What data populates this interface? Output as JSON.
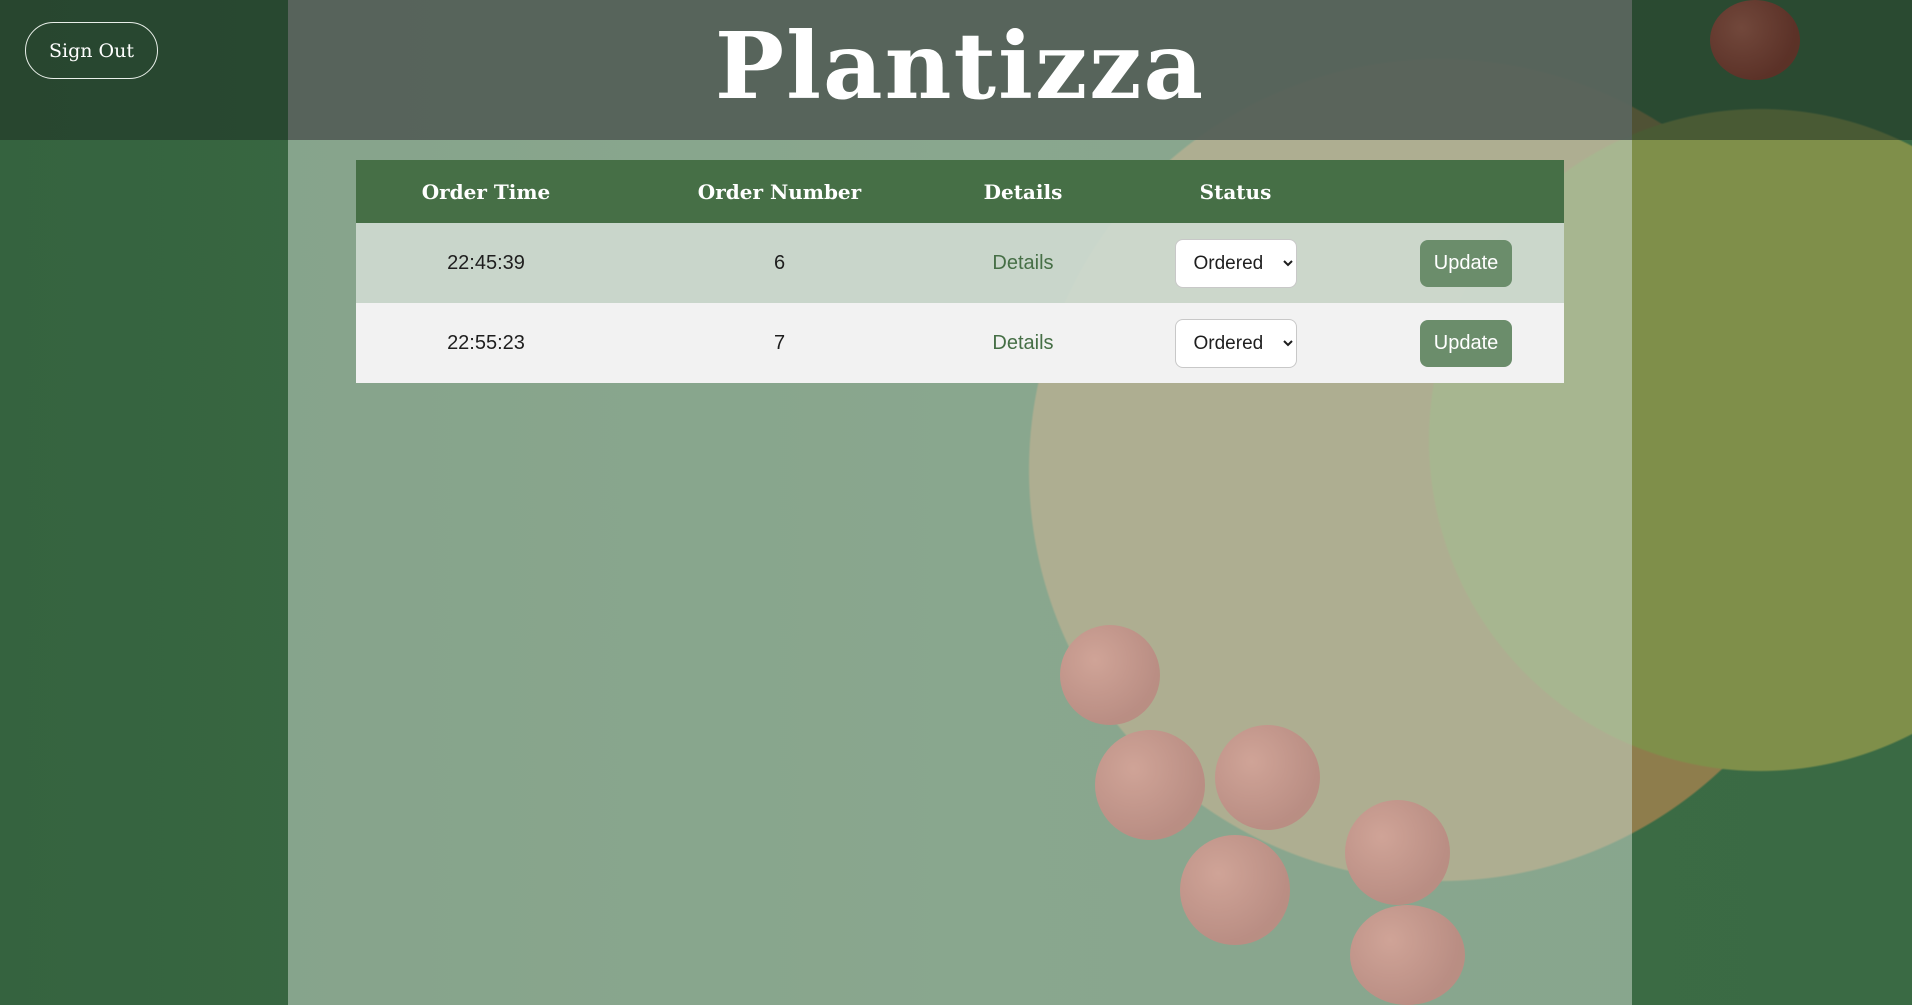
{
  "header": {
    "brand": "Plantizza",
    "sign_out_label": "Sign Out"
  },
  "table": {
    "columns": [
      "Order Time",
      "Order Number",
      "Details",
      "Status",
      ""
    ],
    "rows": [
      {
        "time": "22:45:39",
        "number": "6",
        "details": "Details",
        "status": "Ordered",
        "action": "Update"
      },
      {
        "time": "22:55:23",
        "number": "7",
        "details": "Details",
        "status": "Ordered",
        "action": "Update"
      }
    ]
  },
  "colors": {
    "accent": "#466f46",
    "button": "#6b8d6b"
  }
}
